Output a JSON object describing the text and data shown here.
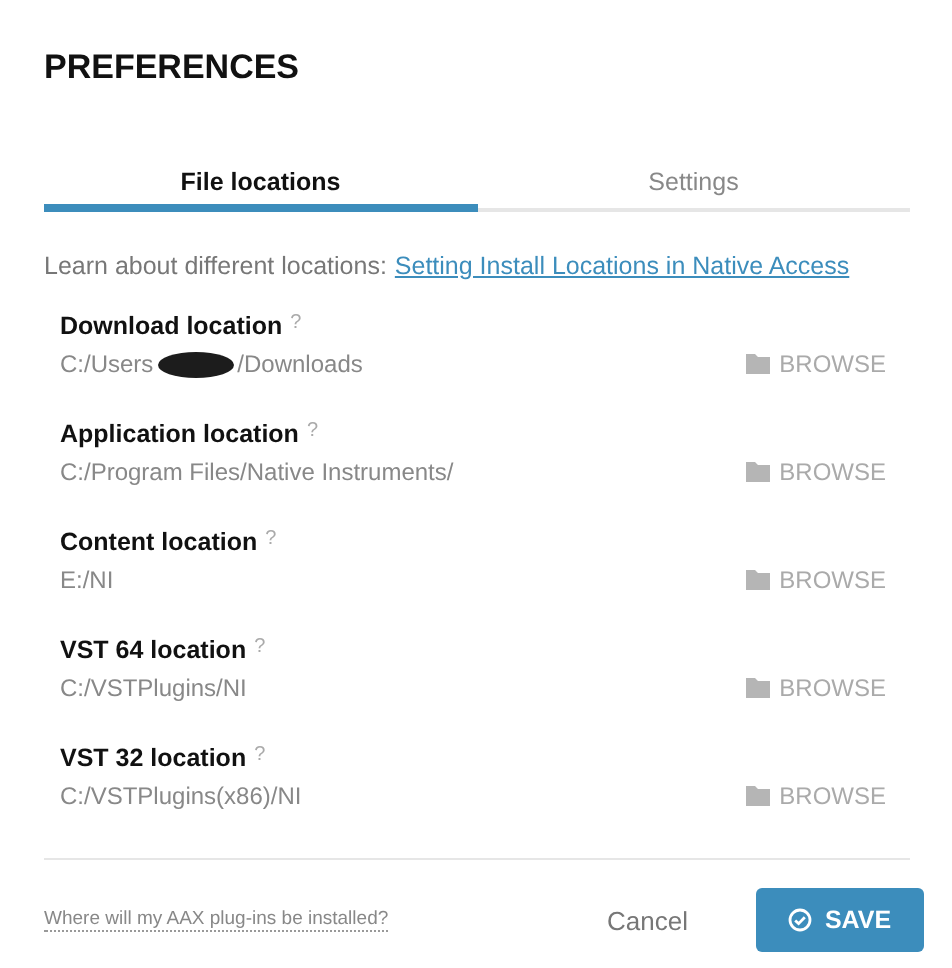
{
  "title": "PREFERENCES",
  "tabs": [
    {
      "label": "File locations",
      "selected": true
    },
    {
      "label": "Settings",
      "selected": false
    }
  ],
  "intro": {
    "text": "Learn about different locations:",
    "link": "Setting Install Locations in Native Access"
  },
  "locations": [
    {
      "label": "Download location",
      "help": "?",
      "path": "C:/Users",
      "redacted": true,
      "path_after": "/Downloads",
      "action": "BROWSE"
    },
    {
      "label": "Application location",
      "help": "?",
      "path": "C:/Program Files/Native Instruments/",
      "action": "BROWSE"
    },
    {
      "label": "Content location",
      "help": "?",
      "path": "E:/NI",
      "action": "BROWSE"
    },
    {
      "label": "VST 64 location",
      "help": "?",
      "path": "C:/VSTPlugins/NI",
      "action": "BROWSE"
    },
    {
      "label": "VST 32 location",
      "help": "?",
      "path": "C:/VSTPlugins(x86)/NI",
      "action": "BROWSE"
    }
  ],
  "footer": {
    "help_link": "Where will my AAX plug-ins be installed?",
    "cancel": "Cancel",
    "save": "SAVE"
  }
}
